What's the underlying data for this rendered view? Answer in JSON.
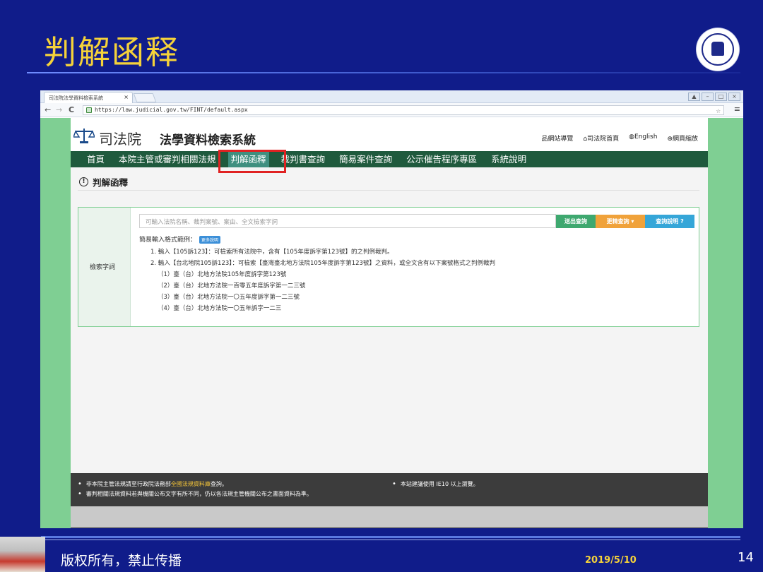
{
  "slide": {
    "title": "判解函释",
    "footer_text": "版权所有，禁止传播",
    "date": "2019/5/10",
    "page_number": "14"
  },
  "browser": {
    "tab_title": "司法院法學資料檢索系統",
    "tab_close": "×",
    "url": "https://law.judicial.gov.tw/FINT/default.aspx",
    "back": "←",
    "forward": "→",
    "reload": "C",
    "star": "☆",
    "menu": "≡",
    "window_controls": [
      "▲",
      "–",
      "□",
      "×"
    ]
  },
  "site": {
    "name_main": "司法院",
    "name_sub": "法學資料檢索系統",
    "top_links": [
      "網站導覽",
      "司法院首頁",
      "English",
      "網頁縮放"
    ],
    "nav_items": [
      "首頁",
      "本院主管或審判相關法規",
      "判解函釋",
      "裁判書查詢",
      "簡易案件查詢",
      "公示催告程序專區",
      "系統說明"
    ],
    "active_nav": "判解函釋",
    "section_title": "判解函釋",
    "search": {
      "label": "檢索字詞",
      "placeholder": "可輸入法院名稱、裁判案號、案由、全文檢索字詞",
      "submit": "送出查詢",
      "more": "更精查詢 ▾",
      "help": "查詢說明 ?",
      "hint_title": "簡易輸入格式範例：",
      "hint_badge": "更多說明",
      "hint_lines": [
        "1. 輸入【105訴123】：可檢索所有法院中，含有【105年度訴字第123號】的之判例裁判。",
        "2. 輸入【台北地院105訴123】：可檢索【臺灣臺北地方法院105年度訴字第123號】之資料，或全文含有以下案號格式之判例裁判",
        "（1）臺（台）北地方法院105年度訴字第123號",
        "（2）臺（台）北地方法院一百零五年度訴字第一二三號",
        "（3）臺（台）北地方法院一〇五年度訴字第一二三號",
        "（4）臺（台）北地方法院一〇五年訴字一二三"
      ]
    },
    "footer": {
      "line1_pre": "非本院主管法規請至行政院法務部",
      "line1_link": "全國法規資料庫",
      "line1_post": "查詢。",
      "line2": "審判相關法規資料若與機關公布文字有所不同，仍以各法規主管機關公布之書面資料為準。",
      "line3": "本站建議使用 IE10 以上瀏覽。"
    }
  },
  "colors": {
    "slide_bg": "#101c8a",
    "title": "#f5d23a",
    "nav_bg": "#1f5a3d",
    "highlight": "#e02222"
  }
}
